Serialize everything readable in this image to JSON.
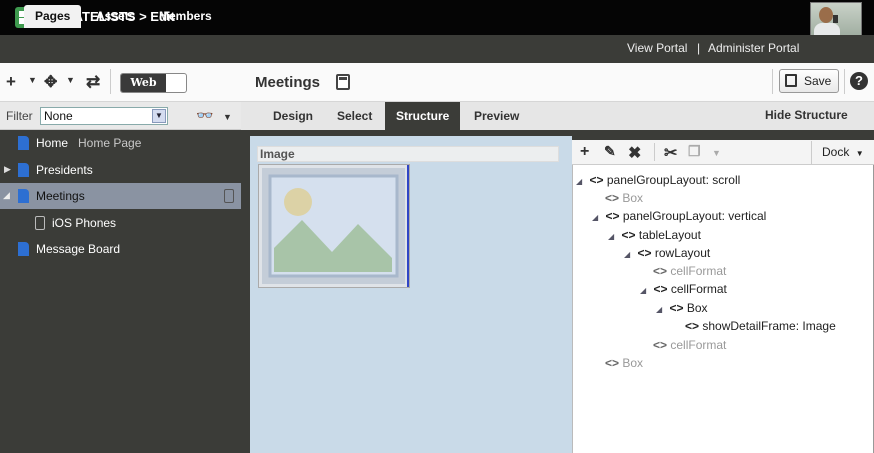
{
  "app": {
    "title": "PHILATELISTS > Edit"
  },
  "top_tabs": [
    {
      "label": "Pages"
    },
    {
      "label": "Assets"
    },
    {
      "label": "Members"
    }
  ],
  "top_links": {
    "view_portal": "View Portal",
    "separator": "|",
    "administer_portal": "Administer Portal"
  },
  "toolbar": {
    "web_toggle": "Web",
    "page_name": "Meetings",
    "save_label": "Save",
    "help": "?"
  },
  "filter": {
    "label": "Filter",
    "value": "None"
  },
  "page_tree": [
    {
      "label": "Home",
      "sub": "Home Page"
    },
    {
      "label": "Presidents"
    },
    {
      "label": "Meetings"
    },
    {
      "label": "iOS Phones"
    },
    {
      "label": "Message Board"
    }
  ],
  "sub_tabs": [
    {
      "label": "Design"
    },
    {
      "label": "Select"
    },
    {
      "label": "Structure"
    },
    {
      "label": "Preview"
    }
  ],
  "hide_structure": "Hide Structure",
  "canvas": {
    "image_header": "Image"
  },
  "structure": {
    "dock_label": "Dock",
    "nodes": [
      {
        "label": "panelGroupLayout: scroll"
      },
      {
        "label": "Box"
      },
      {
        "label": "panelGroupLayout: vertical"
      },
      {
        "label": "tableLayout"
      },
      {
        "label": "rowLayout"
      },
      {
        "label": "cellFormat"
      },
      {
        "label": "cellFormat"
      },
      {
        "label": "Box"
      },
      {
        "label": "showDetailFrame: Image"
      },
      {
        "label": "cellFormat"
      },
      {
        "label": "Box"
      }
    ]
  },
  "colors": {
    "accent_blue": "#2d6fd2",
    "selected_row": "#8a93a2",
    "dark_bg": "#3b3c38"
  }
}
